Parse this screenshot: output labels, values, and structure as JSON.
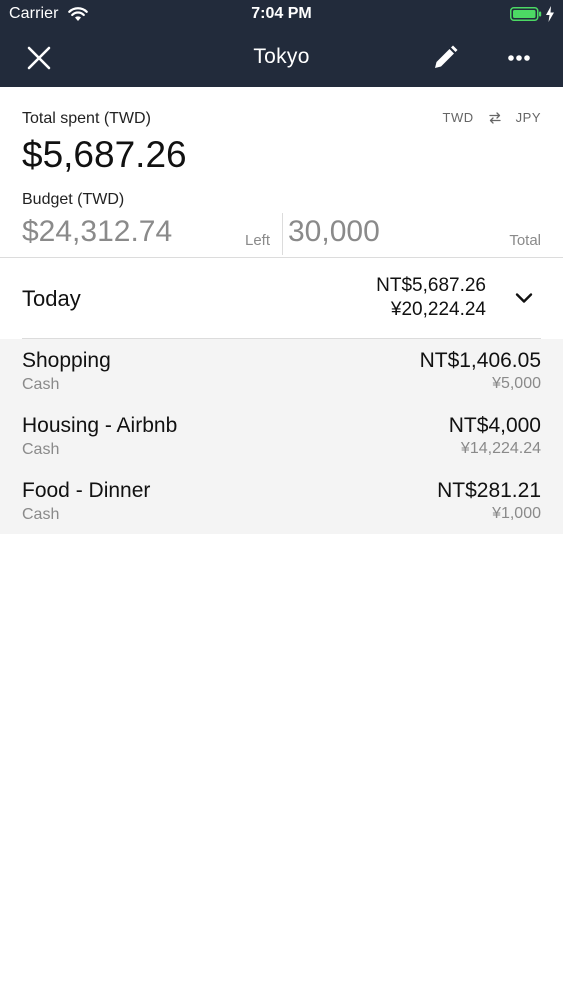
{
  "status_bar": {
    "carrier": "Carrier",
    "time": "7:04 PM",
    "battery_color": "#4cd964"
  },
  "header": {
    "title": "Tokyo",
    "background": "#222b3b",
    "icons": {
      "close": "close-icon",
      "edit": "pencil-icon",
      "more": "more-icon"
    }
  },
  "summary": {
    "total_label": "Total spent (TWD)",
    "total_amount": "$5,687.26",
    "currency_from": "TWD",
    "currency_to": "JPY",
    "budget_label": "Budget (TWD)",
    "budget_left": "$24,312.74",
    "left_label": "Left",
    "budget_total": "30,000",
    "total_word": "Total"
  },
  "day": {
    "label": "Today",
    "amount_twd": "NT$5,687.26",
    "amount_jpy": "¥20,224.24"
  },
  "expenses": [
    {
      "title": "Shopping",
      "method": "Cash",
      "amount_twd": "NT$1,406.05",
      "amount_jpy": "¥5,000"
    },
    {
      "title": "Housing - Airbnb",
      "method": "Cash",
      "amount_twd": "NT$4,000",
      "amount_jpy": "¥14,224.24"
    },
    {
      "title": "Food - Dinner",
      "method": "Cash",
      "amount_twd": "NT$281.21",
      "amount_jpy": "¥1,000"
    }
  ]
}
